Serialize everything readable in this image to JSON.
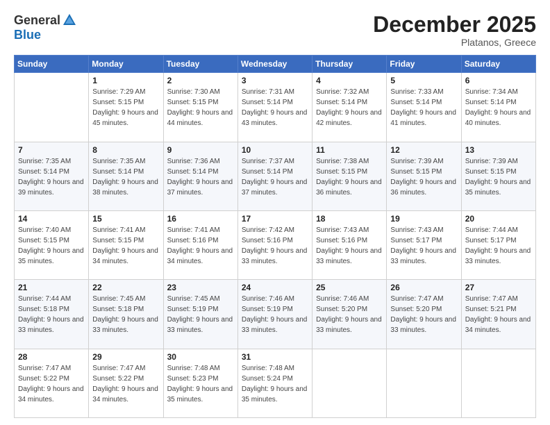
{
  "logo": {
    "general": "General",
    "blue": "Blue"
  },
  "header": {
    "month": "December 2025",
    "location": "Platanos, Greece"
  },
  "weekdays": [
    "Sunday",
    "Monday",
    "Tuesday",
    "Wednesday",
    "Thursday",
    "Friday",
    "Saturday"
  ],
  "weeks": [
    [
      {
        "day": "",
        "sunrise": "",
        "sunset": "",
        "daylight": ""
      },
      {
        "day": "1",
        "sunrise": "Sunrise: 7:29 AM",
        "sunset": "Sunset: 5:15 PM",
        "daylight": "Daylight: 9 hours and 45 minutes."
      },
      {
        "day": "2",
        "sunrise": "Sunrise: 7:30 AM",
        "sunset": "Sunset: 5:15 PM",
        "daylight": "Daylight: 9 hours and 44 minutes."
      },
      {
        "day": "3",
        "sunrise": "Sunrise: 7:31 AM",
        "sunset": "Sunset: 5:14 PM",
        "daylight": "Daylight: 9 hours and 43 minutes."
      },
      {
        "day": "4",
        "sunrise": "Sunrise: 7:32 AM",
        "sunset": "Sunset: 5:14 PM",
        "daylight": "Daylight: 9 hours and 42 minutes."
      },
      {
        "day": "5",
        "sunrise": "Sunrise: 7:33 AM",
        "sunset": "Sunset: 5:14 PM",
        "daylight": "Daylight: 9 hours and 41 minutes."
      },
      {
        "day": "6",
        "sunrise": "Sunrise: 7:34 AM",
        "sunset": "Sunset: 5:14 PM",
        "daylight": "Daylight: 9 hours and 40 minutes."
      }
    ],
    [
      {
        "day": "7",
        "sunrise": "Sunrise: 7:35 AM",
        "sunset": "Sunset: 5:14 PM",
        "daylight": "Daylight: 9 hours and 39 minutes."
      },
      {
        "day": "8",
        "sunrise": "Sunrise: 7:35 AM",
        "sunset": "Sunset: 5:14 PM",
        "daylight": "Daylight: 9 hours and 38 minutes."
      },
      {
        "day": "9",
        "sunrise": "Sunrise: 7:36 AM",
        "sunset": "Sunset: 5:14 PM",
        "daylight": "Daylight: 9 hours and 37 minutes."
      },
      {
        "day": "10",
        "sunrise": "Sunrise: 7:37 AM",
        "sunset": "Sunset: 5:14 PM",
        "daylight": "Daylight: 9 hours and 37 minutes."
      },
      {
        "day": "11",
        "sunrise": "Sunrise: 7:38 AM",
        "sunset": "Sunset: 5:15 PM",
        "daylight": "Daylight: 9 hours and 36 minutes."
      },
      {
        "day": "12",
        "sunrise": "Sunrise: 7:39 AM",
        "sunset": "Sunset: 5:15 PM",
        "daylight": "Daylight: 9 hours and 36 minutes."
      },
      {
        "day": "13",
        "sunrise": "Sunrise: 7:39 AM",
        "sunset": "Sunset: 5:15 PM",
        "daylight": "Daylight: 9 hours and 35 minutes."
      }
    ],
    [
      {
        "day": "14",
        "sunrise": "Sunrise: 7:40 AM",
        "sunset": "Sunset: 5:15 PM",
        "daylight": "Daylight: 9 hours and 35 minutes."
      },
      {
        "day": "15",
        "sunrise": "Sunrise: 7:41 AM",
        "sunset": "Sunset: 5:15 PM",
        "daylight": "Daylight: 9 hours and 34 minutes."
      },
      {
        "day": "16",
        "sunrise": "Sunrise: 7:41 AM",
        "sunset": "Sunset: 5:16 PM",
        "daylight": "Daylight: 9 hours and 34 minutes."
      },
      {
        "day": "17",
        "sunrise": "Sunrise: 7:42 AM",
        "sunset": "Sunset: 5:16 PM",
        "daylight": "Daylight: 9 hours and 33 minutes."
      },
      {
        "day": "18",
        "sunrise": "Sunrise: 7:43 AM",
        "sunset": "Sunset: 5:16 PM",
        "daylight": "Daylight: 9 hours and 33 minutes."
      },
      {
        "day": "19",
        "sunrise": "Sunrise: 7:43 AM",
        "sunset": "Sunset: 5:17 PM",
        "daylight": "Daylight: 9 hours and 33 minutes."
      },
      {
        "day": "20",
        "sunrise": "Sunrise: 7:44 AM",
        "sunset": "Sunset: 5:17 PM",
        "daylight": "Daylight: 9 hours and 33 minutes."
      }
    ],
    [
      {
        "day": "21",
        "sunrise": "Sunrise: 7:44 AM",
        "sunset": "Sunset: 5:18 PM",
        "daylight": "Daylight: 9 hours and 33 minutes."
      },
      {
        "day": "22",
        "sunrise": "Sunrise: 7:45 AM",
        "sunset": "Sunset: 5:18 PM",
        "daylight": "Daylight: 9 hours and 33 minutes."
      },
      {
        "day": "23",
        "sunrise": "Sunrise: 7:45 AM",
        "sunset": "Sunset: 5:19 PM",
        "daylight": "Daylight: 9 hours and 33 minutes."
      },
      {
        "day": "24",
        "sunrise": "Sunrise: 7:46 AM",
        "sunset": "Sunset: 5:19 PM",
        "daylight": "Daylight: 9 hours and 33 minutes."
      },
      {
        "day": "25",
        "sunrise": "Sunrise: 7:46 AM",
        "sunset": "Sunset: 5:20 PM",
        "daylight": "Daylight: 9 hours and 33 minutes."
      },
      {
        "day": "26",
        "sunrise": "Sunrise: 7:47 AM",
        "sunset": "Sunset: 5:20 PM",
        "daylight": "Daylight: 9 hours and 33 minutes."
      },
      {
        "day": "27",
        "sunrise": "Sunrise: 7:47 AM",
        "sunset": "Sunset: 5:21 PM",
        "daylight": "Daylight: 9 hours and 34 minutes."
      }
    ],
    [
      {
        "day": "28",
        "sunrise": "Sunrise: 7:47 AM",
        "sunset": "Sunset: 5:22 PM",
        "daylight": "Daylight: 9 hours and 34 minutes."
      },
      {
        "day": "29",
        "sunrise": "Sunrise: 7:47 AM",
        "sunset": "Sunset: 5:22 PM",
        "daylight": "Daylight: 9 hours and 34 minutes."
      },
      {
        "day": "30",
        "sunrise": "Sunrise: 7:48 AM",
        "sunset": "Sunset: 5:23 PM",
        "daylight": "Daylight: 9 hours and 35 minutes."
      },
      {
        "day": "31",
        "sunrise": "Sunrise: 7:48 AM",
        "sunset": "Sunset: 5:24 PM",
        "daylight": "Daylight: 9 hours and 35 minutes."
      },
      {
        "day": "",
        "sunrise": "",
        "sunset": "",
        "daylight": ""
      },
      {
        "day": "",
        "sunrise": "",
        "sunset": "",
        "daylight": ""
      },
      {
        "day": "",
        "sunrise": "",
        "sunset": "",
        "daylight": ""
      }
    ]
  ]
}
